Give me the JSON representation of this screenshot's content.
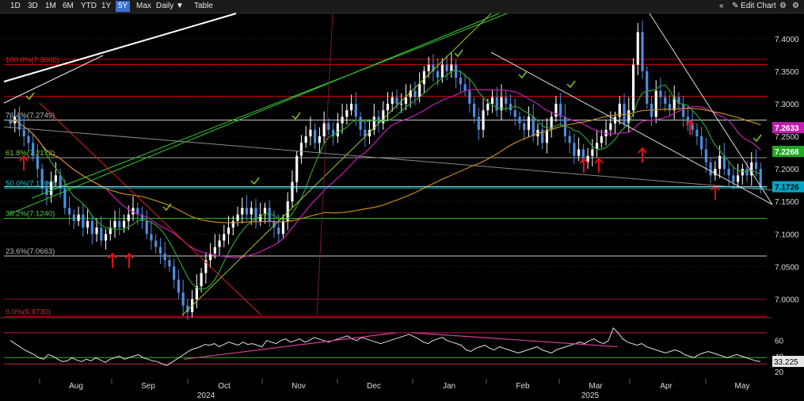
{
  "toolbar": {
    "ranges": [
      "1D",
      "3D",
      "1M",
      "6M",
      "YTD",
      "1Y",
      "5Y",
      "Max"
    ],
    "active_range": "5Y",
    "interval": "Daily",
    "table_label": "Table",
    "edit_chart_label": "Edit Chart"
  },
  "colors": {
    "up": "#ffffff",
    "down": "#4d8fe0",
    "ma_fast": "#2e9e2e",
    "ma_mid": "#c31fb0",
    "ma_slow": "#c88a1e",
    "fib_line": "#c8c8c8",
    "rsi_line": "#e0e0e0",
    "current_price": "#00a7c8",
    "ma_mid_tag": "#c31fb0",
    "ma_fast_tag": "#22a822",
    "rsi_tag": "#e8e8e8"
  },
  "chart_data": {
    "type": "candlestick",
    "xaxis": {
      "month_labels": [
        "Aug",
        "Sep",
        "Oct",
        "Nov",
        "Dec",
        "Jan",
        "Feb",
        "Mar",
        "Apr",
        "May"
      ],
      "year_labels": [
        "2024",
        "2025"
      ]
    },
    "yaxis": {
      "ticks": [
        "7.4000",
        "7.3500",
        "7.3000",
        "7.2500",
        "7.2000",
        "7.1500",
        "7.1000",
        "7.0500",
        "7.0000"
      ],
      "range": [
        6.975,
        7.435
      ]
    },
    "fib_levels": [
      {
        "label": "100.0%(7.3602)",
        "value": 7.3602
      },
      {
        "label": "76.4%(7.2749)",
        "value": 7.2749
      },
      {
        "label": "61.8%(7.2172)",
        "value": 7.2172
      },
      {
        "label": "50.0%(7.1706)",
        "value": 7.1706
      },
      {
        "label": "38.2%(7.1240)",
        "value": 7.124
      },
      {
        "label": "23.6%(7.0663)",
        "value": 7.0663
      },
      {
        "label": "0.0%(6.9730)",
        "value": 6.973
      }
    ],
    "price_tags": [
      {
        "value": 7.2633,
        "label": "7.2633"
      },
      {
        "value": 7.2268,
        "label": "7.2268"
      },
      {
        "value": 7.1726,
        "label": "7.1726"
      }
    ],
    "ohlc_close": [
      7.27,
      7.28,
      7.26,
      7.25,
      7.24,
      7.22,
      7.2,
      7.17,
      7.16,
      7.18,
      7.19,
      7.17,
      7.14,
      7.13,
      7.12,
      7.13,
      7.11,
      7.12,
      7.1,
      7.11,
      7.09,
      7.1,
      7.11,
      7.12,
      7.11,
      7.12,
      7.13,
      7.14,
      7.13,
      7.12,
      7.1,
      7.09,
      7.08,
      7.07,
      7.06,
      7.05,
      7.03,
      7.01,
      6.99,
      6.98,
      7.0,
      7.02,
      7.04,
      7.06,
      7.07,
      7.08,
      7.09,
      7.1,
      7.11,
      7.12,
      7.13,
      7.14,
      7.13,
      7.14,
      7.12,
      7.13,
      7.14,
      7.12,
      7.11,
      7.1,
      7.12,
      7.15,
      7.18,
      7.22,
      7.24,
      7.25,
      7.26,
      7.24,
      7.25,
      7.27,
      7.26,
      7.25,
      7.27,
      7.28,
      7.29,
      7.3,
      7.28,
      7.26,
      7.25,
      7.26,
      7.28,
      7.27,
      7.29,
      7.3,
      7.31,
      7.3,
      7.3,
      7.31,
      7.32,
      7.31,
      7.33,
      7.35,
      7.36,
      7.35,
      7.34,
      7.36,
      7.35,
      7.36,
      7.34,
      7.33,
      7.32,
      7.3,
      7.28,
      7.26,
      7.29,
      7.3,
      7.31,
      7.29,
      7.31,
      7.3,
      7.29,
      7.28,
      7.27,
      7.26,
      7.28,
      7.25,
      7.26,
      7.24,
      7.26,
      7.28,
      7.3,
      7.28,
      7.25,
      7.24,
      7.22,
      7.23,
      7.21,
      7.22,
      7.23,
      7.24,
      7.25,
      7.26,
      7.27,
      7.28,
      7.3,
      7.27,
      7.29,
      7.36,
      7.41,
      7.35,
      7.3,
      7.28,
      7.32,
      7.31,
      7.3,
      7.29,
      7.31,
      7.3,
      7.28,
      7.27,
      7.26,
      7.25,
      7.23,
      7.21,
      7.19,
      7.2,
      7.22,
      7.2,
      7.19,
      7.18,
      7.19,
      7.2,
      7.19,
      7.21,
      7.2,
      7.17
    ],
    "rsi": {
      "ticks": [
        "60",
        "40",
        "20"
      ],
      "levels": [
        70,
        30
      ],
      "current": "33.225",
      "values": [
        60,
        56,
        52,
        48,
        45,
        42,
        38,
        36,
        42,
        40,
        36,
        33,
        34,
        38,
        35,
        33,
        36,
        34,
        38,
        35,
        32,
        36,
        38,
        40,
        36,
        38,
        40,
        42,
        38,
        36,
        34,
        33,
        30,
        28,
        32,
        36,
        40,
        44,
        48,
        50,
        52,
        55,
        54,
        56,
        52,
        55,
        58,
        56,
        54,
        58,
        55,
        56,
        54,
        52,
        60,
        58,
        56,
        60,
        62,
        58,
        60,
        62,
        58,
        60,
        64,
        62,
        60,
        58,
        60,
        62,
        64,
        66,
        62,
        60,
        64,
        62,
        60,
        58,
        56,
        58,
        60,
        62,
        64,
        66,
        68,
        65,
        62,
        58,
        56,
        60,
        62,
        64,
        60,
        58,
        56,
        54,
        48,
        46,
        50,
        52,
        54,
        50,
        48,
        52,
        50,
        48,
        46,
        44,
        46,
        48,
        50,
        52,
        48,
        46,
        44,
        48,
        50,
        52,
        54,
        56,
        58,
        56,
        60,
        62,
        58,
        56,
        60,
        76,
        70,
        62,
        58,
        56,
        54,
        56,
        52,
        50,
        48,
        46,
        44,
        46,
        48,
        46,
        42,
        40,
        38,
        42,
        44,
        46,
        44,
        42,
        40,
        38,
        40,
        42,
        40,
        38,
        36,
        34,
        33
      ]
    }
  }
}
